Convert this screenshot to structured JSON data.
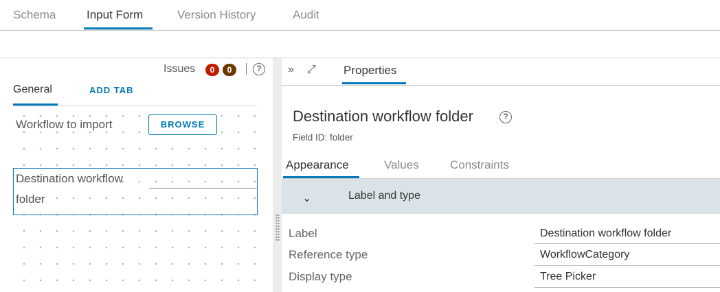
{
  "top_tabs": {
    "schema": "Schema",
    "input_form": "Input Form",
    "version_history": "Version History",
    "audit": "Audit"
  },
  "issues": {
    "label": "Issues",
    "errors": "0",
    "warnings": "0",
    "help": "?"
  },
  "left_tabs": {
    "general": "General",
    "add_tab": "ADD TAB"
  },
  "form": {
    "field1_label": "Workflow to import",
    "browse_label": "BROWSE",
    "field2_label": "Destination workflow folder"
  },
  "right": {
    "collapse_icon": "»",
    "expand_icon": "⤢",
    "properties_tab": "Properties",
    "title": "Destination workflow folder",
    "help": "?",
    "field_id": "Field ID: folder",
    "sub_tabs": {
      "appearance": "Appearance",
      "values": "Values",
      "constraints": "Constraints"
    },
    "accordion": {
      "chevron": "⌄",
      "title": "Label and type"
    },
    "props": [
      {
        "label": "Label",
        "value": "Destination workflow folder"
      },
      {
        "label": "Reference type",
        "value": "WorkflowCategory"
      },
      {
        "label": "Display type",
        "value": "Tree Picker"
      }
    ]
  },
  "colors": {
    "accent": "#0079b8",
    "error_badge": "#c21d00",
    "warning_badge": "#6b3a00",
    "accordion_bg": "#d9e3e8"
  }
}
